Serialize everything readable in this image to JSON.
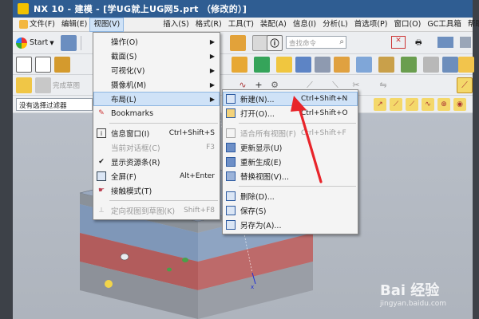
{
  "window": {
    "title": "NX 10 - 建模 - [学UG就上UG网5.prt （修改的）]"
  },
  "menubar": {
    "items": [
      {
        "label": "文件(F)",
        "icon": "file-icon"
      },
      {
        "label": "编辑(E)"
      },
      {
        "label": "视图(V)"
      },
      {
        "label": "插入(S)"
      },
      {
        "label": "格式(R)"
      },
      {
        "label": "工具(T)"
      },
      {
        "label": "装配(A)"
      },
      {
        "label": "信息(I)"
      },
      {
        "label": "分析(L)"
      },
      {
        "label": "首选项(P)"
      },
      {
        "label": "窗口(O)"
      },
      {
        "label": "GC工具箱"
      },
      {
        "label": "帮助(H)"
      }
    ],
    "active_index": 2
  },
  "toolbar": {
    "start_label": "Start",
    "search_placeholder": "查找命令",
    "finish_sketch_label": "完成草图",
    "filter_value": "没有选择过滤器"
  },
  "view_menu": {
    "items": [
      {
        "label": "操作(O)",
        "submenu": true
      },
      {
        "label": "截面(S)",
        "submenu": true
      },
      {
        "label": "可视化(V)",
        "submenu": true
      },
      {
        "label": "摄像机(M)",
        "submenu": true
      },
      {
        "label": "布局(L)",
        "submenu": true,
        "highlighted": true
      },
      {
        "label": "Bookmarks",
        "icon": "bookmark-icon"
      },
      {
        "divider": true
      },
      {
        "label": "信息窗口(I)",
        "shortcut": "Ctrl+Shift+S",
        "icon": "info-window-icon"
      },
      {
        "label": "当前对话框(C)",
        "shortcut": "F3",
        "disabled": true
      },
      {
        "label": "显示资源条(R)",
        "checked": true
      },
      {
        "label": "全屏(F)",
        "shortcut": "Alt+Enter",
        "icon": "fullscreen-icon"
      },
      {
        "label": "接触模式(T)",
        "icon": "touch-mode-icon"
      },
      {
        "divider": true
      },
      {
        "label": "定向视图到草图(K)",
        "shortcut": "Shift+F8",
        "disabled": true
      }
    ]
  },
  "layout_menu": {
    "items": [
      {
        "label": "新建(N)...",
        "shortcut": "Ctrl+Shift+N",
        "highlighted": true,
        "icon": "new-layout-icon"
      },
      {
        "label": "打开(O)...",
        "shortcut": "Ctrl+Shift+O",
        "icon": "open-layout-icon"
      },
      {
        "divider": true
      },
      {
        "label": "适合所有视图(F)",
        "shortcut": "Ctrl+Shift+F",
        "disabled": true,
        "icon": "fit-all-icon"
      },
      {
        "label": "更新显示(U)",
        "icon": "update-display-icon"
      },
      {
        "label": "重新生成(E)",
        "icon": "regenerate-icon"
      },
      {
        "label": "替换视图(V)...",
        "icon": "replace-view-icon"
      },
      {
        "divider": true
      },
      {
        "label": "删除(D)...",
        "icon": "delete-layout-icon"
      },
      {
        "label": "保存(S)",
        "icon": "save-layout-icon"
      },
      {
        "label": "另存为(A)...",
        "icon": "save-as-layout-icon"
      }
    ]
  },
  "watermark": {
    "brand": "Bai 经验",
    "url": "jingyan.baidu.com"
  },
  "colors": {
    "titlebar": "#2f5d92",
    "highlight": "#cfe2f7",
    "arrow": "#e8242a",
    "mold_blue": "#7f97b8",
    "mold_red": "#b25c5c",
    "mold_gray": "#8d9199"
  }
}
